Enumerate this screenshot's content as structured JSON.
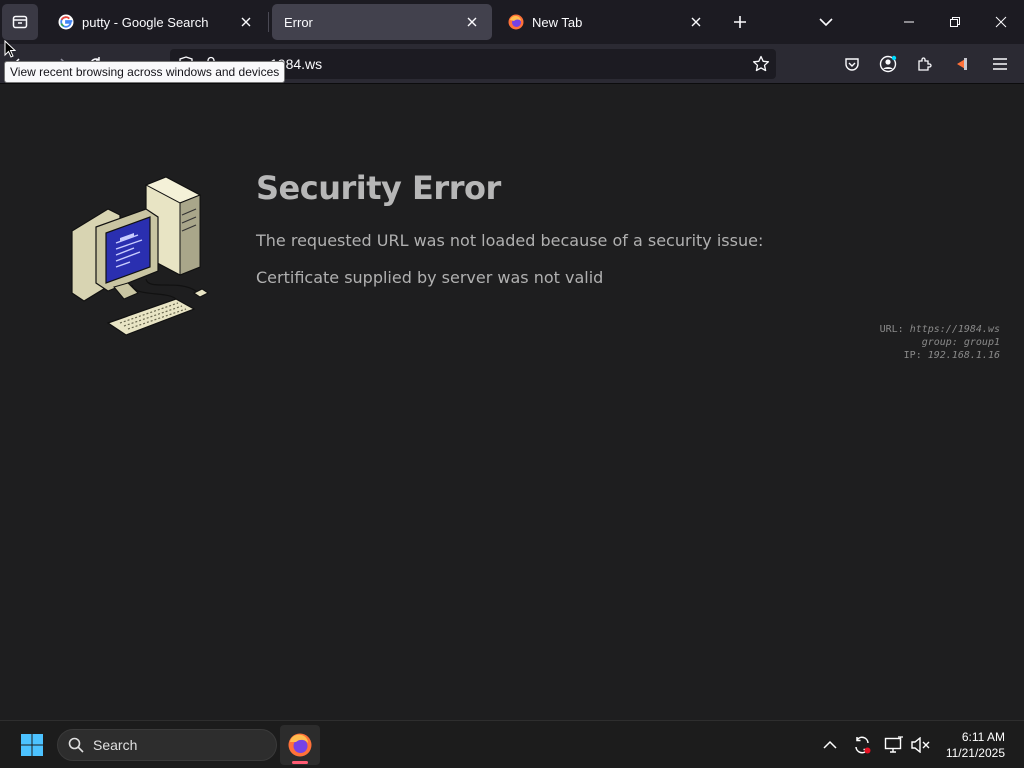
{
  "browser": {
    "tabs": [
      {
        "title": "putty - Google Search",
        "icon": "google-g-icon",
        "active": false
      },
      {
        "title": "Error",
        "icon": "none",
        "active": true
      },
      {
        "title": "New Tab",
        "icon": "firefox-icon",
        "active": false
      }
    ],
    "url_visible": "1984.ws",
    "tooltip": "View recent browsing across windows and devices"
  },
  "page": {
    "title": "Security Error",
    "line1": "The requested URL was not loaded because of a security issue:",
    "line2": "Certificate supplied by server was not valid",
    "meta": {
      "url_key": "URL:",
      "url_value": "https://1984.ws",
      "group_key": "group:",
      "group_value": "group1",
      "ip_key": "IP:",
      "ip_value": "192.168.1.16"
    }
  },
  "taskbar": {
    "search_label": "Search",
    "time": "6:11 AM",
    "date": "11/21/2025"
  },
  "colors": {
    "tabstrip_bg": "#1c1b22",
    "navbar_bg": "#2b2a33",
    "page_bg": "#1e1e1f",
    "title_text": "#b7b7b7",
    "accent_red": "#ff5b73"
  }
}
